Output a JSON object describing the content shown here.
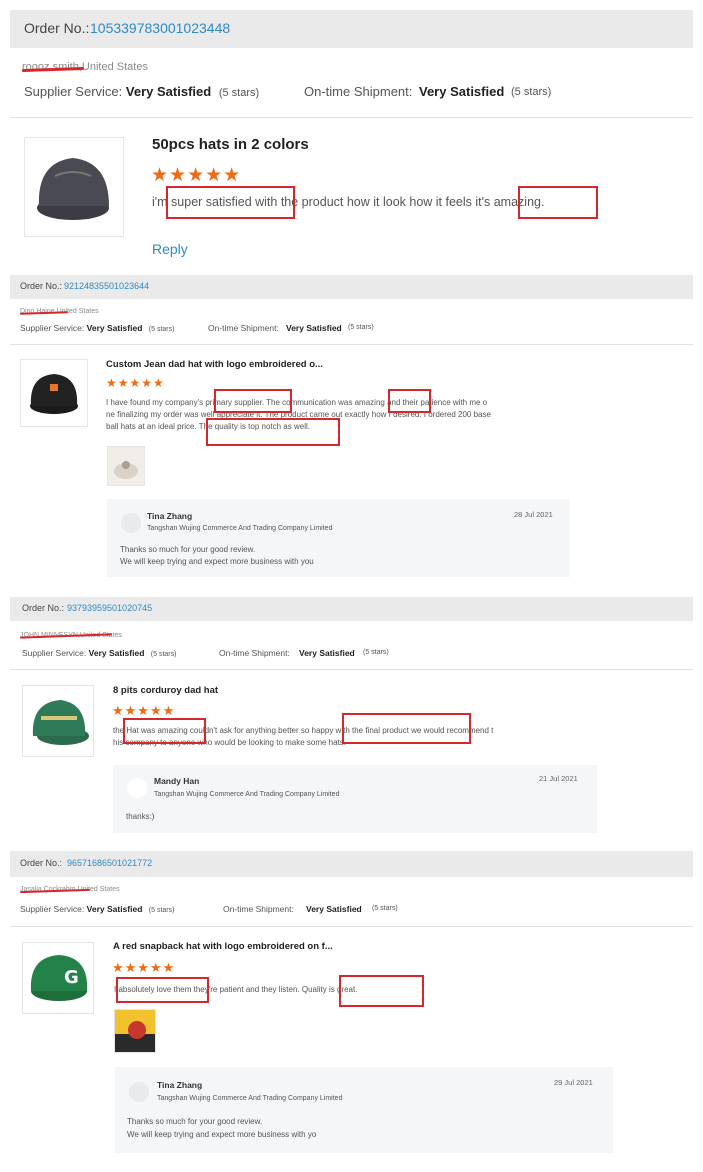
{
  "reviews": [
    {
      "order_label": "Order No.:",
      "order_no": "105339783001023448",
      "buyer": "roooz smith,United States",
      "supplier_service_label": "Supplier Service:",
      "supplier_service_value": "Very Satisfied",
      "supplier_service_stars": "(5 stars)",
      "shipment_label": "On-time Shipment:",
      "shipment_value": "Very Satisfied",
      "shipment_stars": "(5 stars)",
      "title": "50pcs hats in 2 colors",
      "rating": 5,
      "stars": "★★★★★",
      "text": "i'm super satisfied with the product how it look how it feels it's amazing.",
      "reply_link": "Reply"
    },
    {
      "order_label": "Order No.:",
      "order_no": "92124835501023644",
      "buyer": "Dino Haine,United States",
      "supplier_service_label": "Supplier Service:",
      "supplier_service_value": "Very Satisfied",
      "supplier_service_stars": "(5 stars)",
      "shipment_label": "On-time Shipment:",
      "shipment_value": "Very Satisfied",
      "shipment_stars": "(5 stars)",
      "title": "Custom Jean dad hat with logo embroidered o...",
      "rating": 5,
      "stars": "★★★★★",
      "text_lines": [
        "I have found my company's primary supplier. The communication was amazing and their patience with me o",
        "ne finalizing my order was well appreciate it. The product came out exactly how I desired. I ordered 200 base",
        "ball hats at an ideal price. The quality is top notch as well."
      ],
      "reply": {
        "name": "Tina Zhang",
        "company": "Tangshan Wujing Commerce And Trading Company Limited",
        "date": "28 Jul 2021",
        "lines": [
          "Thanks so much for your good review.",
          "We will keep trying and expect more business with you"
        ]
      }
    },
    {
      "order_label": "Order No.:",
      "order_no": "93793959501020745",
      "buyer": "JOHN MINNESYN,United States",
      "supplier_service_label": "Supplier Service:",
      "supplier_service_value": "Very Satisfied",
      "supplier_service_stars": "(5 stars)",
      "shipment_label": "On-time Shipment:",
      "shipment_value": "Very Satisfied",
      "shipment_stars": "(5 stars)",
      "title": "8 pits corduroy dad hat",
      "rating": 5,
      "stars": "★★★★★",
      "text_lines": [
        "the Hat was amazing couldn't ask for anything better so happy with the final product we would recommend t",
        "his company to anyone who would be looking to make some hats."
      ],
      "reply": {
        "name": "Mandy Han",
        "company": "Tangshan Wujing Commerce And Trading Company Limited",
        "date": "21 Jul 2021",
        "lines": [
          "thanks:)"
        ]
      }
    },
    {
      "order_label": "Order No.:",
      "order_no": "96571686501021772",
      "buyer": "Jasalia Cockrahm,United States",
      "supplier_service_label": "Supplier Service:",
      "supplier_service_value": "Very Satisfied",
      "supplier_service_stars": "(5 stars)",
      "shipment_label": "On-time Shipment:",
      "shipment_value": "Very Satisfied",
      "shipment_stars": "(5 stars)",
      "title": "A red snapback hat with logo embroidered on f...",
      "rating": 5,
      "stars": "★★★★★",
      "text": "I absolutely love them they're patient and they listen. Quality is great.",
      "reply": {
        "name": "Tina Zhang",
        "company": "Tangshan Wujing Commerce And Trading Company Limited",
        "date": "29 Jul 2021",
        "lines": [
          "Thanks so much for your good review.",
          "We will keep trying and expect more business with yo"
        ]
      }
    }
  ],
  "colors": {
    "accent_link": "#2f8ac9",
    "star": "#f06a10",
    "highlight": "#d8262d",
    "order_bar": "#eaeaea"
  },
  "icons": [
    "cap-photo",
    "star-icon",
    "avatar-icon",
    "attached-photo"
  ]
}
